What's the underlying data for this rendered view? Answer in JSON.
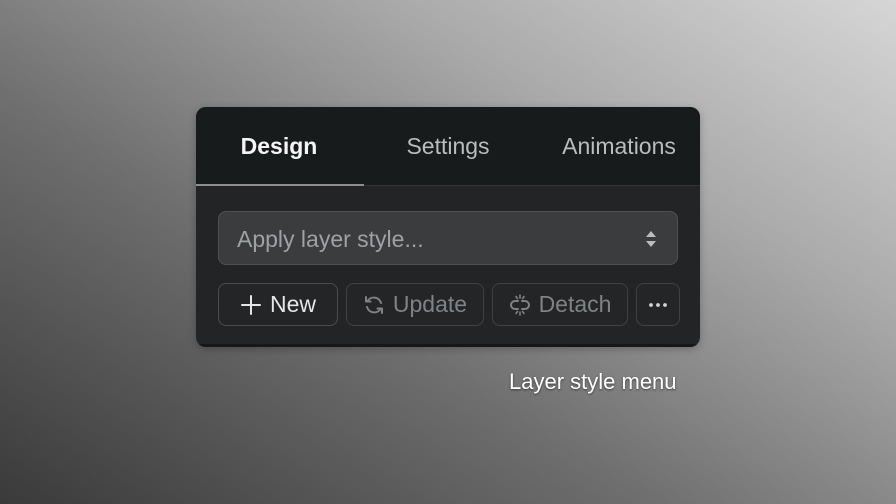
{
  "tabs": [
    {
      "label": "Design",
      "active": true
    },
    {
      "label": "Settings",
      "active": false
    },
    {
      "label": "Animations",
      "active": false
    }
  ],
  "style_select": {
    "placeholder": "Apply layer style..."
  },
  "actions": {
    "new_label": "New",
    "update_label": "Update",
    "detach_label": "Detach"
  },
  "caption": "Layer style menu",
  "colors": {
    "panel_bg": "#222425",
    "tabbar_bg": "#181b1c",
    "active_text": "#f4f5f6",
    "inactive_text": "#b9bdbf",
    "disabled_text": "#7f8386"
  }
}
